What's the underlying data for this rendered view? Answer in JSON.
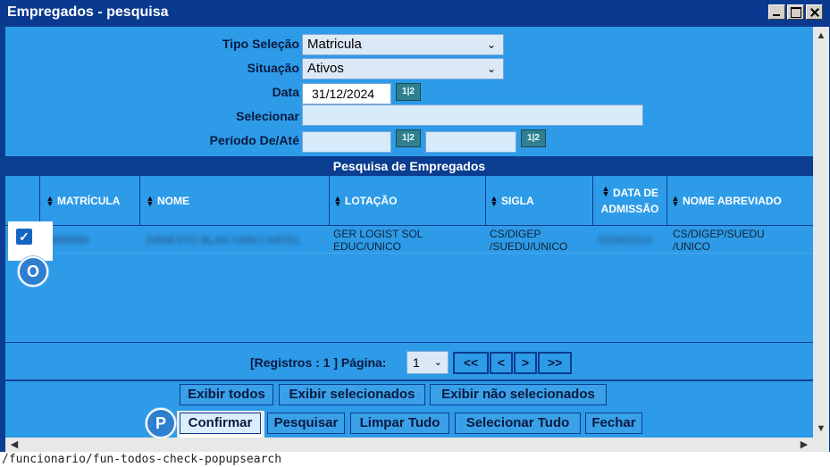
{
  "window": {
    "title": "Empregados - pesquisa"
  },
  "form": {
    "tipo_selecao": {
      "label": "Tipo Seleção",
      "value": "Matricula"
    },
    "situacao": {
      "label": "Situação",
      "value": "Ativos"
    },
    "data": {
      "label": "Data",
      "value": "31/12/2024"
    },
    "selecionar": {
      "label": "Selecionar",
      "value": ""
    },
    "periodo": {
      "label": "Período De/Até",
      "de": "",
      "ate": ""
    },
    "calendar_icon_text": "1|2"
  },
  "grid": {
    "title": "Pesquisa de Empregados",
    "columns": [
      "MATRÍCULA",
      "NOME",
      "LOTAÇÃO",
      "SIGLA",
      "DATA DE ADMISSÃO",
      "NOME ABREVIADO"
    ],
    "rows": [
      {
        "checked": true,
        "matricula": "9999999",
        "nome": "ERNESTO BLAS HABCI NATEL",
        "lotacao": "GER LOGIST SOL EDUC/UNICO",
        "sigla": "CS/DIGEP /SUEDU/UNICO",
        "data_admissao": "02/05/2019",
        "nome_abreviado": "CS/DIGEP/SUEDU /UNICO"
      }
    ]
  },
  "pager": {
    "registros_text": "[Registros : 1 ] Página:",
    "page": "1",
    "first": "<<",
    "prev": "<",
    "next": ">",
    "last": ">>"
  },
  "buttons": {
    "exibir_todos": "Exibir todos",
    "exibir_selecionados": "Exibir selecionados",
    "exibir_nao_selecionados": "Exibir não selecionados",
    "confirmar": "Confirmar",
    "pesquisar": "Pesquisar",
    "limpar_tudo": "Limpar Tudo",
    "selecionar_tudo": "Selecionar Tudo",
    "fechar": "Fechar"
  },
  "markers": {
    "checkbox_marker": "O",
    "confirm_marker": "P"
  },
  "status_url": "/funcionario/fun-todos-check-popupsearch",
  "colors": {
    "title_bar": "#0a3a90",
    "panel": "#2d9be8",
    "header_row": "#0b3d91"
  }
}
